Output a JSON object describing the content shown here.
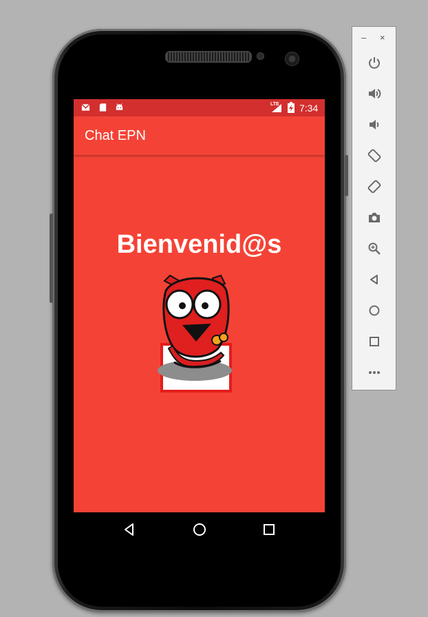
{
  "statusbar": {
    "time": "7:34",
    "network": "LTE",
    "icons": [
      "gmail-icon",
      "sd-card-icon",
      "android-icon",
      "signal-icon",
      "battery-charging-icon"
    ]
  },
  "appbar": {
    "title": "Chat EPN"
  },
  "main": {
    "welcome_text": "Bienvenid@s",
    "mascot": "red-devil-mascot-image"
  },
  "navbar": {
    "icons": [
      "back-icon",
      "home-icon",
      "recents-icon"
    ]
  },
  "emulator_toolbar": {
    "minimize": "–",
    "close": "×",
    "icons": [
      "power-icon",
      "volume-up-icon",
      "volume-down-icon",
      "rotate-left-icon",
      "rotate-right-icon",
      "camera-icon",
      "zoom-icon",
      "back-icon",
      "home-icon",
      "overview-icon",
      "more-icon"
    ]
  },
  "colors": {
    "primary": "#f44336",
    "primary_dark": "#d32f2f",
    "toolbar_icon": "#6a6a6a"
  }
}
